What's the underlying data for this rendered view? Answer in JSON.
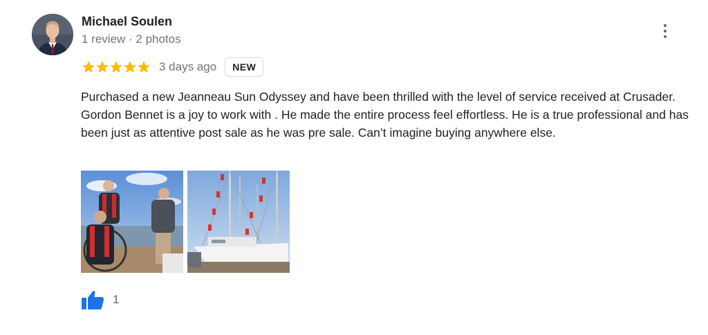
{
  "author": {
    "name": "Michael Soulen",
    "meta": "1 review · 2 photos"
  },
  "rating": {
    "stars": 5,
    "max": 5,
    "star_color": "#fbbc04"
  },
  "date": "3 days ago",
  "badge": "NEW",
  "review_text": "Purchased a new Jeanneau Sun Odyssey and have been thrilled with the level of service received at Crusader. Gordon Bennet is a joy to work with . He made the entire process feel effortless. He is a true professional and has been just as attentive post sale as he was pre sale. Can’t imagine buying anywhere else.",
  "photos": [
    {
      "description_icon": "sailing-crew-photo"
    },
    {
      "description_icon": "marina-yacht-photo"
    }
  ],
  "likes": {
    "count": "1",
    "icon": "thumbs-up-icon",
    "color": "#1a73e8"
  },
  "menu_icon": "more-vert-icon"
}
